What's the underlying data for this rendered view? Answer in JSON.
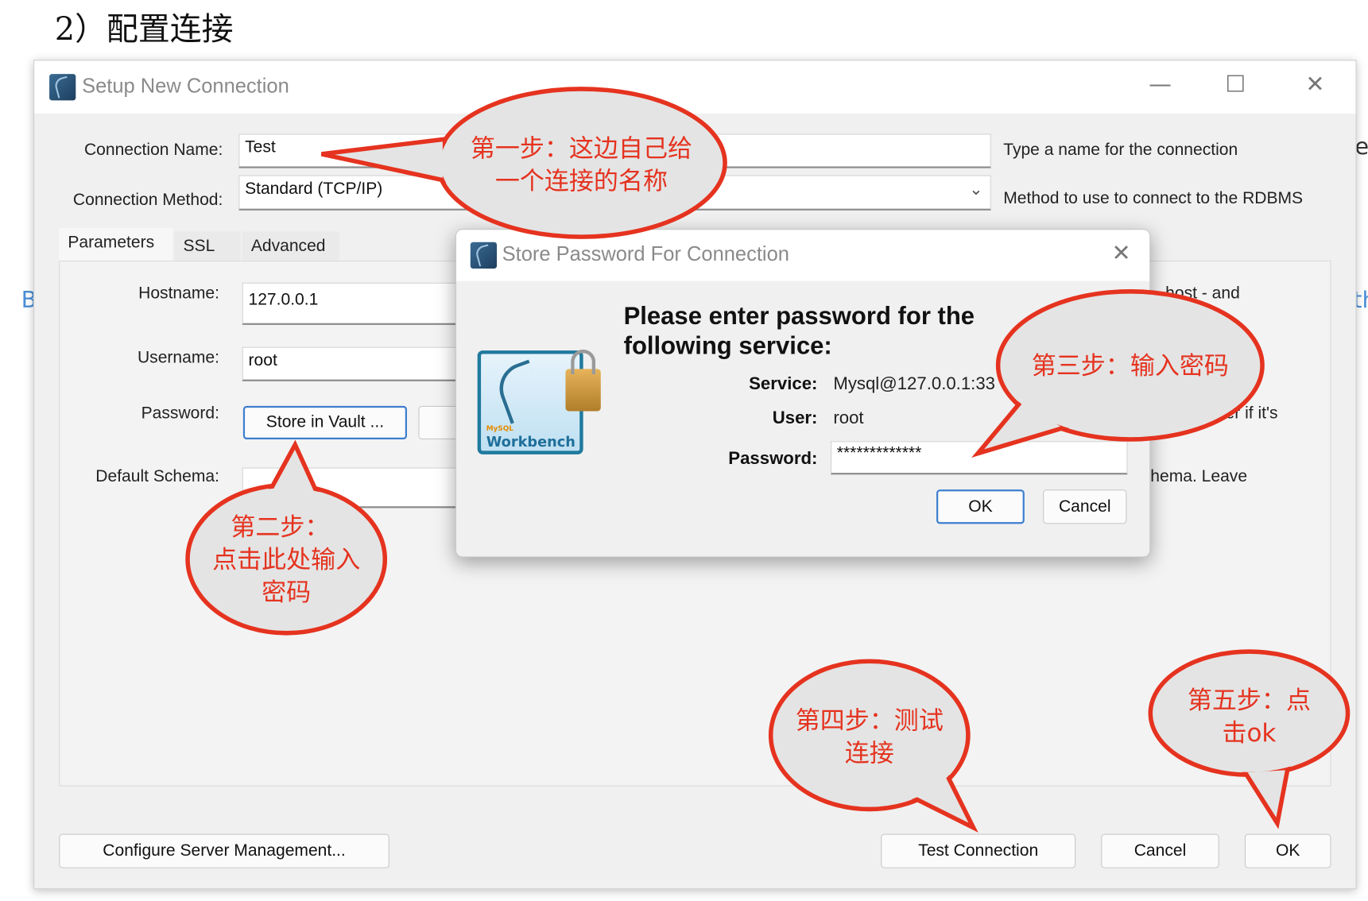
{
  "heading": "2）配置连接",
  "background_fragments": {
    "left": "B",
    "right_top": "e",
    "right_mid": "th"
  },
  "window": {
    "title": "Setup New Connection",
    "controls": {
      "minimize": "—",
      "maximize": "☐",
      "close": "✕"
    },
    "connection_name": {
      "label": "Connection Name:",
      "value": "Test",
      "help": "Type a name for the connection"
    },
    "connection_method": {
      "label": "Connection Method:",
      "value": "Standard (TCP/IP)",
      "help": "Method to use to connect to the RDBMS"
    },
    "tabs": [
      {
        "label": "Parameters",
        "active": true
      },
      {
        "label": "SSL"
      },
      {
        "label": "Advanced"
      }
    ],
    "params": {
      "hostname": {
        "label": "Hostname:",
        "value": "127.0.0.1",
        "help": "host - and"
      },
      "username": {
        "label": "Username:",
        "value": "root"
      },
      "password": {
        "label": "Password:",
        "store_button": "Store in Vault ...",
        "help": "er if it's"
      },
      "default_schema": {
        "label": "Default Schema:",
        "value": "",
        "help": "hema. Leave"
      }
    },
    "buttons": {
      "configure": "Configure Server Management...",
      "test": "Test Connection",
      "cancel": "Cancel",
      "ok": "OK"
    }
  },
  "dialog": {
    "title": "Store Password For Connection",
    "close": "✕",
    "logo": {
      "small": "MySQL",
      "name": "Workbench"
    },
    "heading_line1": "Please enter password for the",
    "heading_line2": "following service:",
    "service": {
      "label": "Service:",
      "value": "Mysql@127.0.0.1:33"
    },
    "user": {
      "label": "User:",
      "value": "root"
    },
    "password": {
      "label": "Password:",
      "value": "*************"
    },
    "ok": "OK",
    "cancel": "Cancel"
  },
  "callouts": [
    {
      "lines": [
        "第一步：这边自己给",
        "一个连接的名称"
      ]
    },
    {
      "lines": [
        "第二步：",
        "点击此处输入",
        "密码"
      ]
    },
    {
      "lines": [
        "第三步：输入密码"
      ]
    },
    {
      "lines": [
        "第四步：测试",
        "连接"
      ]
    },
    {
      "lines": [
        "第五步：点",
        "击ok"
      ]
    }
  ],
  "colors": {
    "callout_stroke": "#e5331f",
    "callout_fill": "#e4e4e4",
    "primary_button_border": "#3d7ed0"
  }
}
